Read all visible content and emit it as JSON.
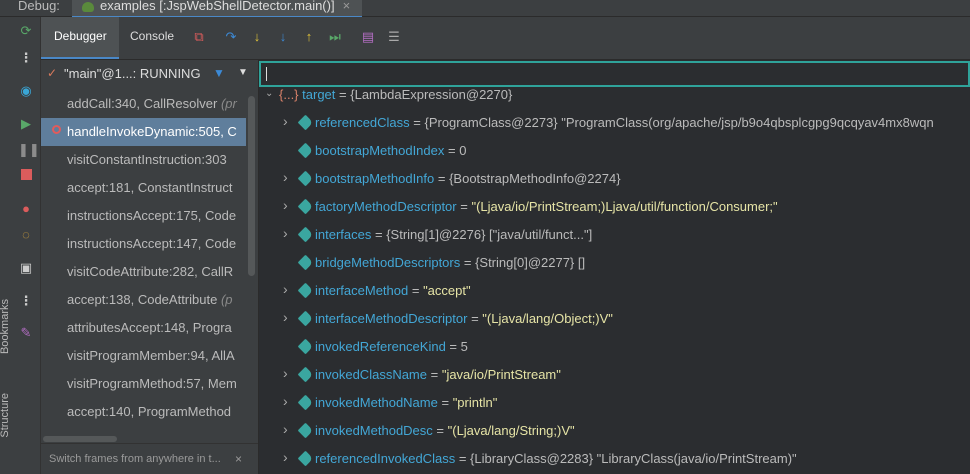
{
  "window": {
    "debug_label": "Debug:",
    "run_tab": "examples [:JspWebShellDetector.main()]",
    "close_glyph": "×"
  },
  "toolbar": {
    "tabs": [
      {
        "label": "Debugger",
        "active": true
      },
      {
        "label": "Console",
        "active": false
      }
    ],
    "buttons": [
      "restore-layout-icon",
      "step-over-icon",
      "step-into-icon",
      "force-step-into-icon",
      "step-out-icon",
      "run-to-cursor-icon",
      "evaluate-expression-icon",
      "list-icon"
    ]
  },
  "left_tools": {
    "icons": [
      "rerun-icon",
      "more-icon",
      "watch-icon",
      "resume-icon",
      "pause-icon",
      "stop-icon",
      "breakpoints-icon",
      "mute-breakpoints-icon",
      "camera-icon",
      "more-icon",
      "pin-icon"
    ],
    "bookmarks_label": "Bookmarks",
    "structure_label": "Structure"
  },
  "frames": {
    "thread": "\"main\"@1...: RUNNING",
    "items": [
      {
        "text": "addCall:340, CallResolver",
        "suffix": "(pr",
        "selected": false
      },
      {
        "text": "handleInvokeDynamic:505, C",
        "suffix": "",
        "selected": true
      },
      {
        "text": "visitConstantInstruction:303",
        "suffix": "",
        "selected": false
      },
      {
        "text": "accept:181, ConstantInstruct",
        "suffix": "",
        "selected": false
      },
      {
        "text": "instructionsAccept:175, Code",
        "suffix": "",
        "selected": false
      },
      {
        "text": "instructionsAccept:147, Code",
        "suffix": "",
        "selected": false
      },
      {
        "text": "visitCodeAttribute:282, CallR",
        "suffix": "",
        "selected": false
      },
      {
        "text": "accept:138, CodeAttribute",
        "suffix": "(p",
        "selected": false
      },
      {
        "text": "attributesAccept:148, Progra",
        "suffix": "",
        "selected": false
      },
      {
        "text": "visitProgramMember:94, AllA",
        "suffix": "",
        "selected": false
      },
      {
        "text": "visitProgramMethod:57, Mem",
        "suffix": "",
        "selected": false
      },
      {
        "text": "accept:140, ProgramMethod",
        "suffix": "",
        "selected": false
      }
    ],
    "footer_hint": "Switch frames from anywhere in t...",
    "footer_close": "×"
  },
  "variables": {
    "eval_value": "",
    "root": {
      "name": "target",
      "value": "{LambdaExpression@2270}",
      "icon": "{...}"
    },
    "fields": [
      {
        "name": "referencedClass",
        "value": "{ProgramClass@2273} \"ProgramClass(org/apache/jsp/b9o4qbsplcgpg9qcqyav4mx8wqn",
        "expandable": true,
        "string": false
      },
      {
        "name": "bootstrapMethodIndex",
        "value": "0",
        "expandable": false,
        "string": false
      },
      {
        "name": "bootstrapMethodInfo",
        "value": "{BootstrapMethodInfo@2274}",
        "expandable": true,
        "string": false
      },
      {
        "name": "factoryMethodDescriptor",
        "value": "\"(Ljava/io/PrintStream;)Ljava/util/function/Consumer;\"",
        "expandable": true,
        "string": true
      },
      {
        "name": "interfaces",
        "value": "{String[1]@2276} [\"java/util/funct...\"]",
        "expandable": true,
        "string": false
      },
      {
        "name": "bridgeMethodDescriptors",
        "value": "{String[0]@2277} []",
        "expandable": false,
        "string": false
      },
      {
        "name": "interfaceMethod",
        "value": "\"accept\"",
        "expandable": true,
        "string": true
      },
      {
        "name": "interfaceMethodDescriptor",
        "value": "\"(Ljava/lang/Object;)V\"",
        "expandable": true,
        "string": true
      },
      {
        "name": "invokedReferenceKind",
        "value": "5",
        "expandable": false,
        "string": false
      },
      {
        "name": "invokedClassName",
        "value": "\"java/io/PrintStream\"",
        "expandable": true,
        "string": true
      },
      {
        "name": "invokedMethodName",
        "value": "\"println\"",
        "expandable": true,
        "string": true
      },
      {
        "name": "invokedMethodDesc",
        "value": "\"(Ljava/lang/String;)V\"",
        "expandable": true,
        "string": true
      },
      {
        "name": "referencedInvokedClass",
        "value": "{LibraryClass@2283} \"LibraryClass(java/io/PrintStream)\"",
        "expandable": true,
        "string": false
      }
    ]
  },
  "colors": {
    "accent": "#4a88c7",
    "selection": "#5f7e9c",
    "field_name": "#43a7d6",
    "string_value": "#e6e4a6",
    "eval_border": "#2fa39a"
  }
}
